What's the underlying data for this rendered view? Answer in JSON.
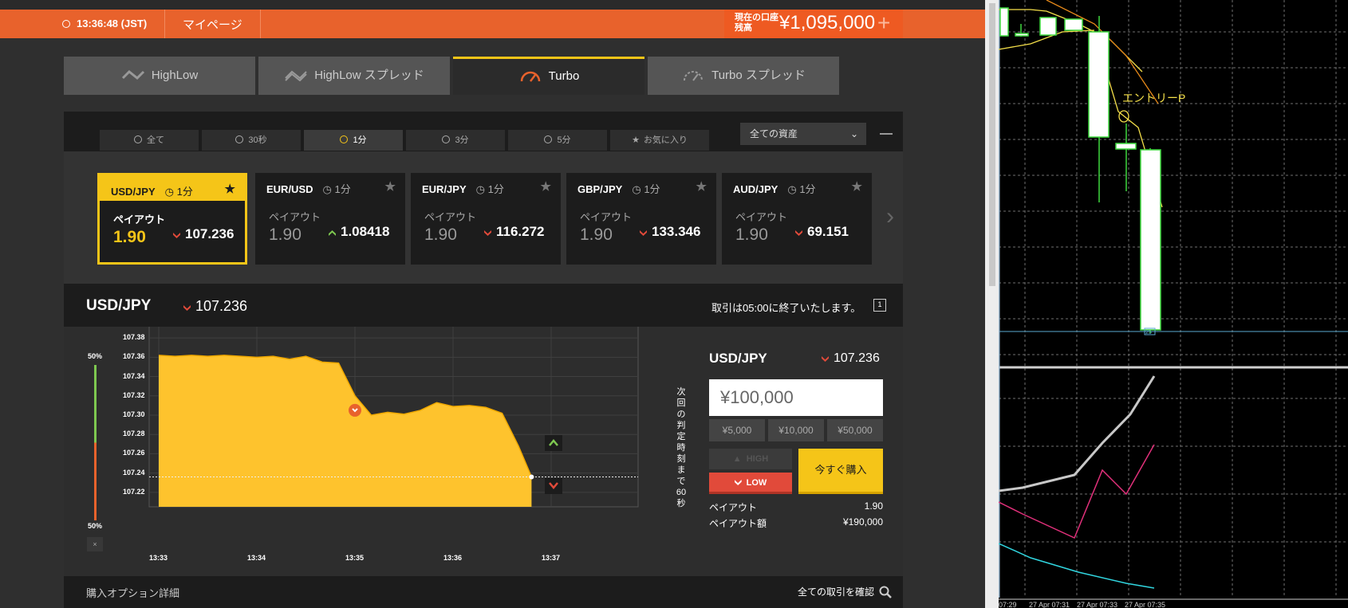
{
  "header": {
    "time": "13:36:48 (JST)",
    "mypage": "マイページ",
    "balance_label": "現在の口座残高",
    "balance": "¥1,095,000",
    "plus": "+"
  },
  "tabs": [
    {
      "label": "HighLow"
    },
    {
      "label": "HighLow スプレッド"
    },
    {
      "label": "Turbo"
    },
    {
      "label": "Turbo スプレッド"
    }
  ],
  "filters": [
    {
      "label": "全て"
    },
    {
      "label": "30秒"
    },
    {
      "label": "1分"
    },
    {
      "label": "3分"
    },
    {
      "label": "5分"
    },
    {
      "label": "お気に入り"
    }
  ],
  "asset_select": "全ての資産",
  "cards": [
    {
      "pair": "USD/JPY",
      "duration": "1分",
      "payout_label": "ペイアウト",
      "payout": "1.90",
      "rate": "107.236",
      "dir": "down"
    },
    {
      "pair": "EUR/USD",
      "duration": "1分",
      "payout_label": "ペイアウト",
      "payout": "1.90",
      "rate": "1.08418",
      "dir": "up"
    },
    {
      "pair": "EUR/JPY",
      "duration": "1分",
      "payout_label": "ペイアウト",
      "payout": "1.90",
      "rate": "116.272",
      "dir": "down"
    },
    {
      "pair": "GBP/JPY",
      "duration": "1分",
      "payout_label": "ペイアウト",
      "payout": "1.90",
      "rate": "133.346",
      "dir": "down"
    },
    {
      "pair": "AUD/JPY",
      "duration": "1分",
      "payout_label": "ペイアウト",
      "payout": "1.90",
      "rate": "69.151",
      "dir": "down"
    }
  ],
  "pair_header": {
    "pair": "USD/JPY",
    "rate": "107.236",
    "close_notice": "取引は05:00に終了いたします。",
    "icon_label": "1"
  },
  "meter": {
    "top": "50%",
    "bottom": "50%",
    "close": "×",
    "high_pct": 50
  },
  "chart_data": {
    "type": "area",
    "instrument": "USD/JPY",
    "yticks": [
      "107.38",
      "107.36",
      "107.34",
      "107.32",
      "107.30",
      "107.28",
      "107.26",
      "107.24",
      "107.22"
    ],
    "ylim": [
      107.205,
      107.39
    ],
    "xticks": [
      "13:33",
      "13:34",
      "13:35",
      "13:36",
      "13:37"
    ],
    "x": [
      "13:33:00",
      "13:33:10",
      "13:33:20",
      "13:33:30",
      "13:33:40",
      "13:33:50",
      "13:34:00",
      "13:34:10",
      "13:34:20",
      "13:34:30",
      "13:34:40",
      "13:34:50",
      "13:35:00",
      "13:35:10",
      "13:35:20",
      "13:35:30",
      "13:35:40",
      "13:35:50",
      "13:36:00",
      "13:36:10",
      "13:36:20",
      "13:36:30",
      "13:36:40",
      "13:36:48"
    ],
    "values": [
      107.362,
      107.361,
      107.362,
      107.361,
      107.362,
      107.361,
      107.36,
      107.361,
      107.358,
      107.361,
      107.355,
      107.354,
      107.32,
      107.3,
      107.303,
      107.301,
      107.305,
      107.313,
      107.309,
      107.31,
      107.308,
      107.302,
      107.268,
      107.236
    ],
    "entry_marker": {
      "x": "13:35:00",
      "y": 107.305,
      "dir": "down"
    },
    "current_rate": 107.236,
    "countdown_label": "次回の判定時刻まで60秒"
  },
  "trade": {
    "pair": "USD/JPY",
    "rate": "107.236",
    "amount": "¥100,000",
    "quick": [
      "¥5,000",
      "¥10,000",
      "¥50,000"
    ],
    "high_label": "HIGH",
    "low_label": "LOW",
    "buy_now": "今すぐ購入",
    "payout_label": "ペイアウト",
    "payout": "1.90",
    "payout_amount_label": "ペイアウト額",
    "payout_amount": "¥190,000"
  },
  "footer": {
    "details": "購入オプション詳細",
    "all_trades": "全ての取引を確認"
  },
  "mt4": {
    "annotation": "エントリーP",
    "box_label": "25",
    "time_labels": [
      "07:29",
      "27 Apr 07:31",
      "27 Apr 07:33",
      "27 Apr 07:35"
    ]
  },
  "colors": {
    "orange": "#e8622c",
    "yellow": "#f5c518",
    "red": "#e14a3a",
    "green": "#7ec850"
  }
}
